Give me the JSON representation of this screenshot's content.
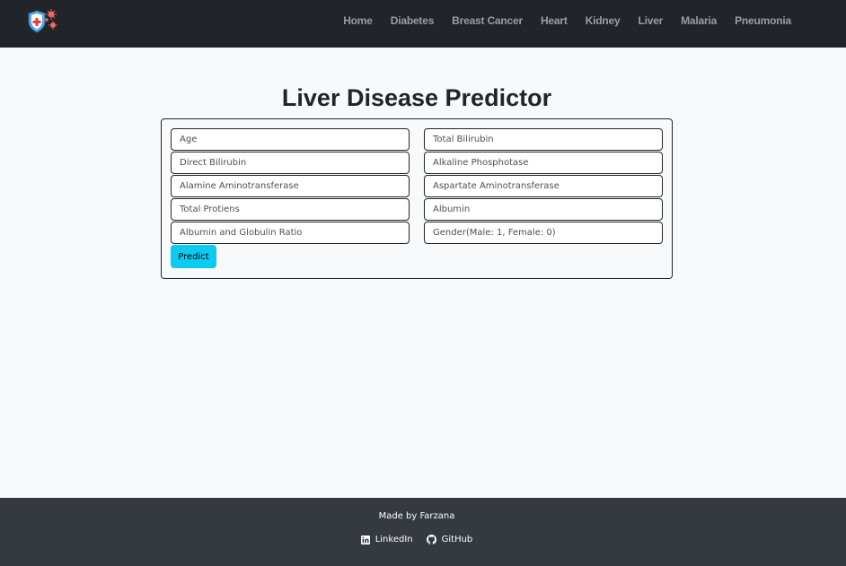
{
  "navbar": {
    "logo_icon": "medical-shield-virus-icon",
    "links": [
      {
        "label": "Home"
      },
      {
        "label": "Diabetes"
      },
      {
        "label": "Breast Cancer"
      },
      {
        "label": "Heart"
      },
      {
        "label": "Kidney"
      },
      {
        "label": "Liver"
      },
      {
        "label": "Malaria"
      },
      {
        "label": "Pneumonia"
      }
    ]
  },
  "main": {
    "title": "Liver Disease Predictor",
    "fields": {
      "age": "Age",
      "total_bilirubin": "Total Bilirubin",
      "direct_bilirubin": "Direct Bilirubin",
      "alkaline_phosphotase": "Alkaline Phosphotase",
      "alamine_aminotransferase": "Alamine Aminotransferase",
      "aspartate_aminotransferase": "Aspartate Aminotransferase",
      "total_protiens": "Total Protiens",
      "albumin": "Albumin",
      "albumin_globulin_ratio": "Albumin and Globulin Ratio",
      "gender": "Gender(Male: 1, Female: 0)"
    },
    "predict_label": "Predict"
  },
  "footer": {
    "text": "Made by Farzana",
    "linkedin_label": "LinkedIn",
    "github_label": "GitHub"
  },
  "colors": {
    "navbar_bg": "#212529",
    "page_bg": "#f8f9fa",
    "button_bg": "#0dcaf0",
    "footer_bg": "#343a40"
  }
}
